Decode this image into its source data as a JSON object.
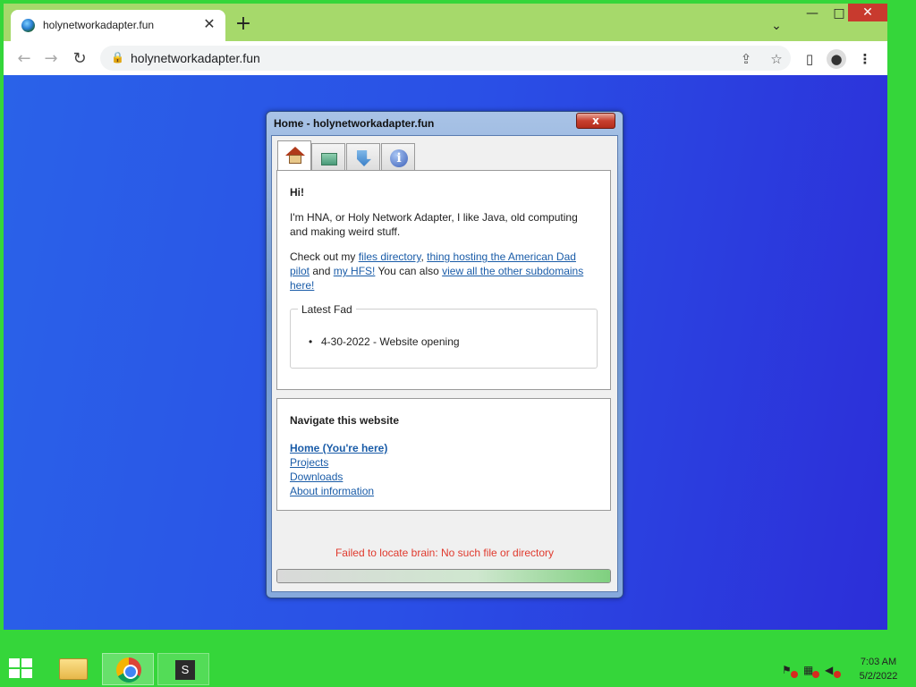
{
  "browser": {
    "tab_title": "holynetworkadapter.fun",
    "url": "holynetworkadapter.fun",
    "tab_close_glyph": "✕",
    "new_tab_glyph": "+",
    "tab_search_glyph": "⌄",
    "minimize_glyph": "—",
    "maximize_glyph": "□",
    "close_glyph": "✕"
  },
  "window": {
    "title": "Home - holynetworkadapter.fun",
    "close_glyph": "x",
    "tabs": [
      {
        "name": "Home",
        "icon": "home-icon"
      },
      {
        "name": "Projects",
        "icon": "projects-icon"
      },
      {
        "name": "Downloads",
        "icon": "downloads-icon"
      },
      {
        "name": "About",
        "icon": "about-icon"
      }
    ]
  },
  "home": {
    "greeting": "Hi!",
    "intro": "I'm HNA, or Holy Network Adapter, I like Java, old computing and making weird stuff.",
    "checkout_prefix": "Check out my ",
    "link_files": "files directory",
    "sep1": ", ",
    "link_american_dad": "thing hosting the American Dad pilot",
    "sep2": " and ",
    "link_hfs": "my HFS!",
    "sep3": " You can also ",
    "link_subdomains": "view all the other subdomains here!",
    "fad_legend": "Latest Fad",
    "fad_items": [
      "4-30-2022 - Website opening"
    ]
  },
  "nav": {
    "heading": "Navigate this website",
    "home": "Home (You're here)",
    "projects": "Projects",
    "downloads": "Downloads",
    "about": "About information"
  },
  "status": {
    "message": "Failed to locate brain: No such file or directory",
    "progress": 1.0
  },
  "taskbar": {
    "time": "7:03 AM",
    "date": "5/2/2022",
    "s_label": "S"
  },
  "colors": {
    "taskbar_bg": "#35d63a",
    "tabstrip_bg": "#a6d96b",
    "page_bg": "#2a55e6",
    "status_red": "#e03a2e",
    "link_blue": "#1a5ca8"
  }
}
